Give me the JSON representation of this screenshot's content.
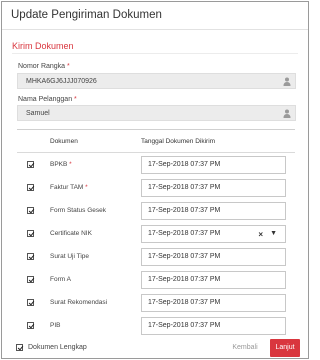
{
  "modal": {
    "title": "Update Pengiriman Dokumen"
  },
  "section": {
    "title": "Kirim Dokumen"
  },
  "fields": {
    "nomor_rangka": {
      "label": "Nomor Rangka",
      "required_mark": "*",
      "value": "MHKA6GJ6JJJ070926"
    },
    "nama_pelanggan": {
      "label": "Nama Pelanggan",
      "required_mark": "*",
      "value": "Samuel"
    }
  },
  "table": {
    "headers": {
      "dokumen": "Dokumen",
      "tanggal": "Tanggal Dokumen Dikirim"
    },
    "rows": [
      {
        "name": "BPKB",
        "required_mark": "*",
        "checked": true,
        "date": "17-Sep-2018 07:37 PM"
      },
      {
        "name": "Faktur TAM",
        "required_mark": "*",
        "checked": true,
        "date": "17-Sep-2018 07:37 PM"
      },
      {
        "name": "Form Status Gesek",
        "required_mark": "",
        "checked": true,
        "date": "17-Sep-2018 07:37 PM"
      },
      {
        "name": "Certificate NIK",
        "required_mark": "",
        "checked": true,
        "date": "17-Sep-2018 07:37 PM"
      },
      {
        "name": "Surat Uji Tipe",
        "required_mark": "",
        "checked": true,
        "date": "17-Sep-2018 07:37 PM"
      },
      {
        "name": "Form A",
        "required_mark": "",
        "checked": true,
        "date": "17-Sep-2018 07:37 PM"
      },
      {
        "name": "Surat Rekomendasi",
        "required_mark": "",
        "checked": true,
        "date": "17-Sep-2018 07:37 PM"
      },
      {
        "name": "PIB",
        "required_mark": "",
        "checked": true,
        "date": "17-Sep-2018 07:37 PM"
      }
    ]
  },
  "footer": {
    "complete_label": "Dokumen Lengkap",
    "complete_checked": true,
    "back_label": "Kembali",
    "next_label": "Lanjut"
  },
  "colors": {
    "accent": "#d9363e",
    "readonly_bg": "#ececec"
  }
}
